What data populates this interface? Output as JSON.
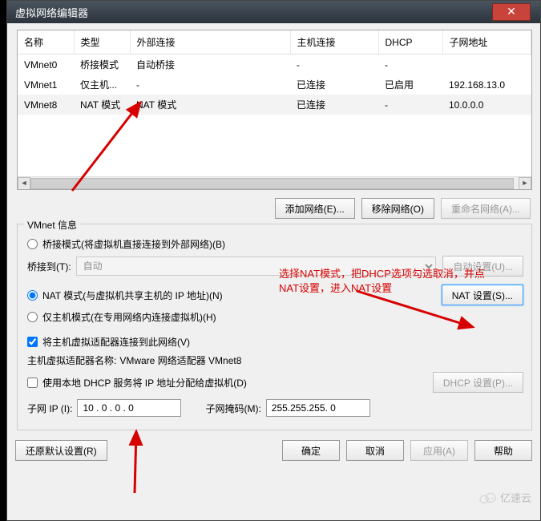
{
  "window": {
    "title": "虚拟网络编辑器",
    "close": "✕"
  },
  "table": {
    "headers": [
      "名称",
      "类型",
      "外部连接",
      "主机连接",
      "DHCP",
      "子网地址"
    ],
    "rows": [
      {
        "name": "VMnet0",
        "type": "桥接模式",
        "ext": "自动桥接",
        "host": "-",
        "dhcp": "-",
        "subnet": ""
      },
      {
        "name": "VMnet1",
        "type": "仅主机...",
        "ext": "-",
        "host": "已连接",
        "dhcp": "已启用",
        "subnet": "192.168.13.0"
      },
      {
        "name": "VMnet8",
        "type": "NAT 模式",
        "ext": "NAT 模式",
        "host": "已连接",
        "dhcp": "-",
        "subnet": "10.0.0.0"
      }
    ]
  },
  "buttons": {
    "add": "添加网络(E)...",
    "remove": "移除网络(O)",
    "rename": "重命名网络(A)...",
    "auto_set": "自动设置(U)...",
    "nat_set": "NAT 设置(S)...",
    "dhcp_set": "DHCP 设置(P)...",
    "restore": "还原默认设置(R)",
    "ok": "确定",
    "cancel": "取消",
    "apply": "应用(A)",
    "help": "帮助"
  },
  "group": {
    "title": "VMnet 信息",
    "bridge": "桥接模式(将虚拟机直接连接到外部网络)(B)",
    "bridge_to": "桥接到(T):",
    "bridge_auto": "自动",
    "nat": "NAT 模式(与虚拟机共享主机的 IP 地址)(N)",
    "hostonly": "仅主机模式(在专用网络内连接虚拟机)(H)",
    "connect_host": "将主机虚拟适配器连接到此网络(V)",
    "adapter_name_label": "主机虚拟适配器名称:",
    "adapter_name": "VMware 网络适配器 VMnet8",
    "use_dhcp": "使用本地 DHCP 服务将 IP 地址分配给虚拟机(D)",
    "subnet_ip_label": "子网 IP (I):",
    "subnet_ip": "10 . 0 . 0 . 0",
    "subnet_mask_label": "子网掩码(M):",
    "subnet_mask": "255.255.255. 0"
  },
  "annotation": {
    "line1": "选择NAT模式，把DHCP选项勾选取消，并点",
    "line2": "NAT设置，进入NAT设置"
  },
  "watermark": "亿速云"
}
